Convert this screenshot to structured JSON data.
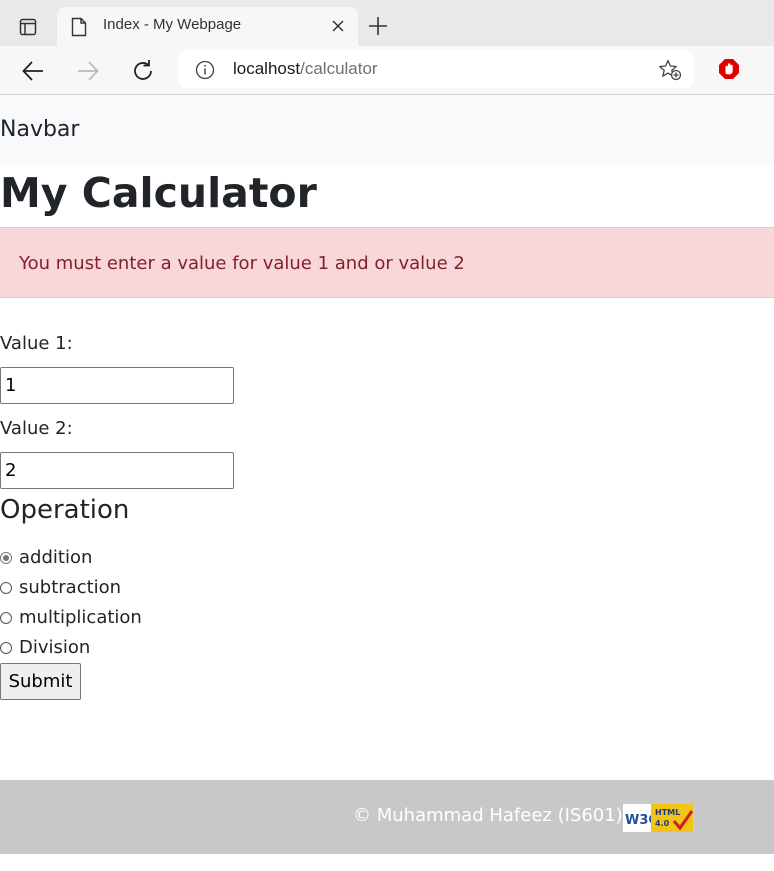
{
  "browser": {
    "tab_title": "Index - My Webpage",
    "url_host": "localhost",
    "url_path": "/calculator"
  },
  "navbar": {
    "brand": "Navbar"
  },
  "page": {
    "title": "My Calculator",
    "alert": "You must enter a value for value 1 and or value 2"
  },
  "form": {
    "value1_label": "Value 1:",
    "value1": "1",
    "value2_label": "Value 2:",
    "value2": "2",
    "operation_title": "Operation",
    "options": [
      {
        "label": "addition",
        "checked": true
      },
      {
        "label": "subtraction",
        "checked": false
      },
      {
        "label": "multiplication",
        "checked": false
      },
      {
        "label": "Division",
        "checked": false
      }
    ],
    "submit_label": "Submit"
  },
  "footer": {
    "copyright": "© Muhammad Hafeez (IS601)",
    "badge_w3c": "W3C",
    "badge_html": "HTML",
    "badge_version": "4.0"
  },
  "colors": {
    "alert_bg": "#f8d7da",
    "alert_text": "#842029",
    "footer_bg": "#c8c8c8",
    "navbar_bg": "#f8f9fa"
  }
}
